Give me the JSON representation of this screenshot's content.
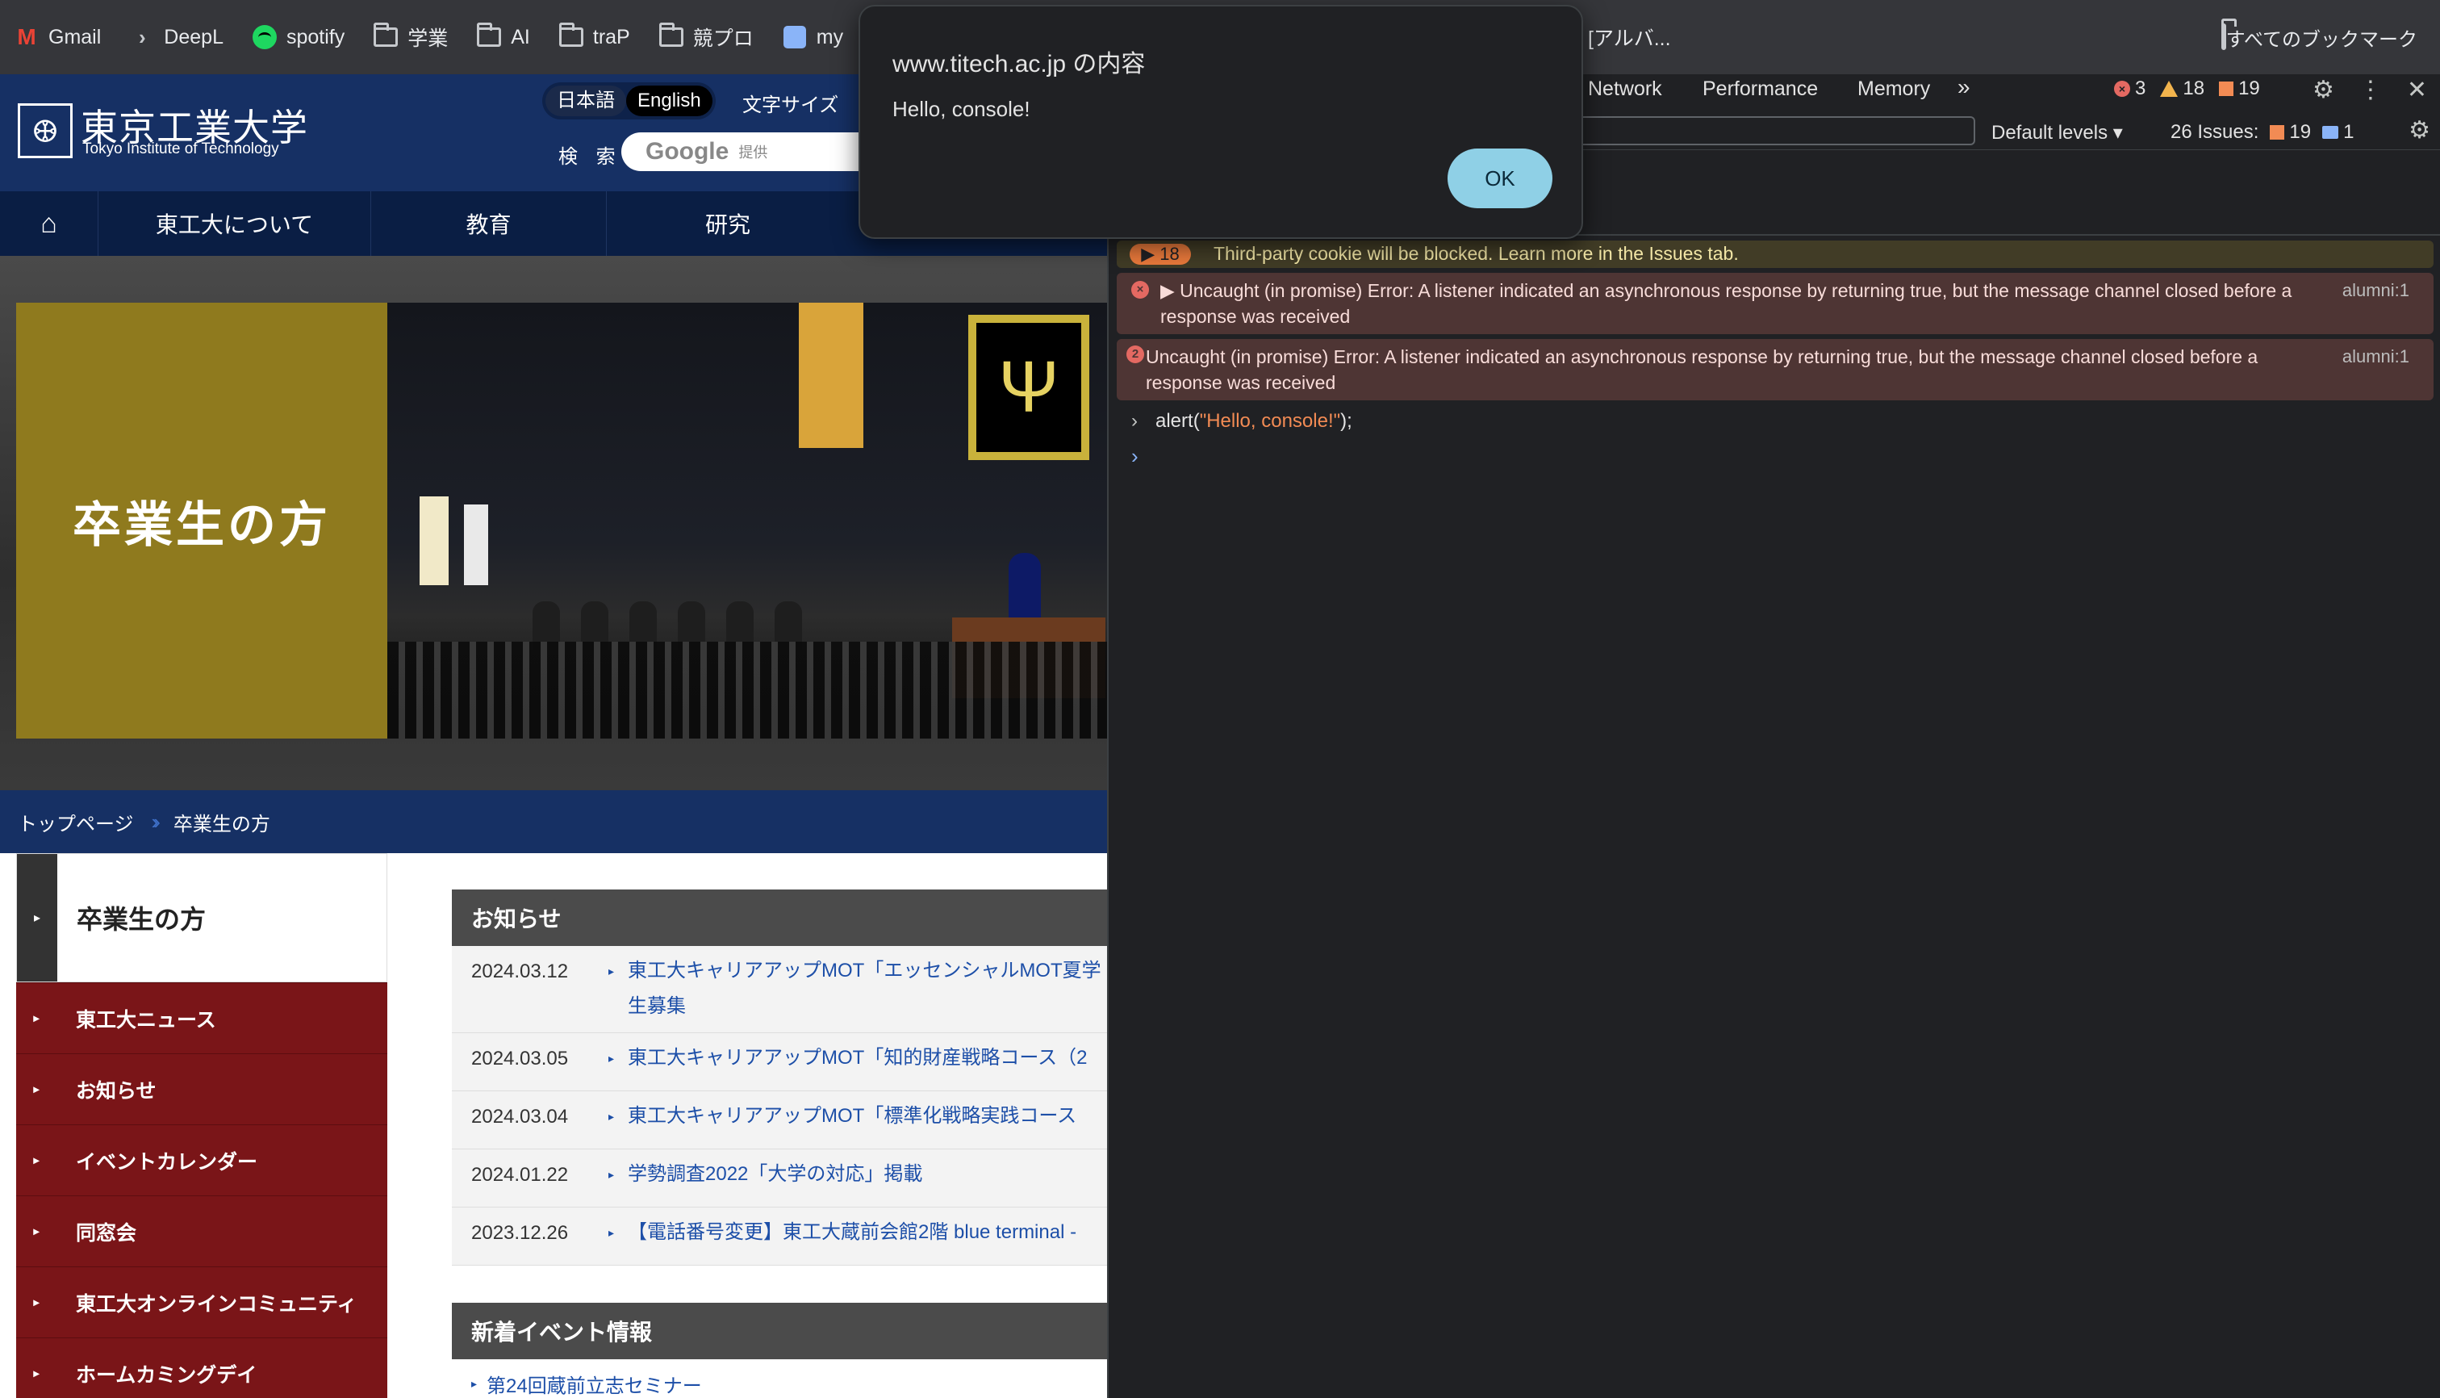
{
  "bookmarks": {
    "items": [
      {
        "label": "Gmail",
        "icon": "gmail-icon"
      },
      {
        "label": "DeepL",
        "icon": "deepl-icon"
      },
      {
        "label": "spotify",
        "icon": "spotify-icon"
      },
      {
        "label": "学業",
        "icon": "folder-icon"
      },
      {
        "label": "AI",
        "icon": "folder-icon"
      },
      {
        "label": "traP",
        "icon": "folder-icon"
      },
      {
        "label": "競プロ",
        "icon": "folder-icon"
      },
      {
        "label": "my",
        "icon": "trello-icon"
      }
    ],
    "partial_item": "[アルバ...",
    "all_bookmarks": "すべてのブックマーク"
  },
  "site": {
    "logo_jp": "東京工業大学",
    "logo_en": "Tokyo Institute of Technology",
    "lang_ja": "日本語",
    "lang_en": "English",
    "font_size": "文字サイズ",
    "search_label": "検 索",
    "search_google": "Google",
    "search_provider": "提供",
    "nav": [
      "東工大について",
      "教育",
      "研究"
    ],
    "hero_title": "卒業生の方",
    "breadcrumb_home": "トップページ",
    "breadcrumb_current": "卒業生の方",
    "sidebar_title": "卒業生の方",
    "sidebar_items": [
      "東工大ニュース",
      "お知らせ",
      "イベントカレンダー",
      "同窓会",
      "東工大オンラインコミュニティ",
      "ホームカミングデイ"
    ],
    "news_heading": "お知らせ",
    "news": [
      {
        "date": "2024.03.12",
        "title": "東工大キャリアアップMOT「エッセンシャルMOT夏学",
        "title2": "生募集"
      },
      {
        "date": "2024.03.05",
        "title": "東工大キャリアアップMOT「知的財産戦略コース（2"
      },
      {
        "date": "2024.03.04",
        "title": "東工大キャリアアップMOT「標準化戦略実践コース"
      },
      {
        "date": "2024.01.22",
        "title": "学勢調査2022「大学の対応」掲載"
      },
      {
        "date": "2023.12.26",
        "title": "【電話番号変更】東工大蔵前会館2階 blue terminal -"
      }
    ],
    "events_heading": "新着イベント情報",
    "event_first": "第24回蔵前立志セミナー"
  },
  "devtools": {
    "tabs": [
      "Network",
      "Performance",
      "Memory"
    ],
    "more": "»",
    "errors_count": "3",
    "warnings_count": "18",
    "issues_count": "19",
    "levels": "Default levels ▾",
    "issues_label": "26 Issues:",
    "issues_flag": "19",
    "issues_msg": "1",
    "console": {
      "warn_badge": "▶ 18",
      "warn_text": "Third-party cookie will be blocked. Learn more in the Issues tab.",
      "error1": "▶ Uncaught (in promise) Error: A listener indicated an asynchronous response by returning true, but the message channel closed before a response was received",
      "error1_src": "alumni:1",
      "error2_count": "2",
      "error2": "Uncaught (in promise) Error: A listener indicated an asynchronous response by returning true, but the message channel closed before a response was received",
      "error2_src": "alumni:1",
      "input_prefix": "alert(",
      "input_string": "\"Hello, console!\"",
      "input_suffix": ");"
    }
  },
  "alert": {
    "title": "www.titech.ac.jp の内容",
    "message": "Hello, console!",
    "ok": "OK"
  },
  "colors": {
    "site_navy": "#163064",
    "sidebar_red": "#7a1518",
    "hero_gold": "#8f7a1e",
    "devtools_bg": "#202124",
    "ok_button": "#8fd0e6"
  }
}
